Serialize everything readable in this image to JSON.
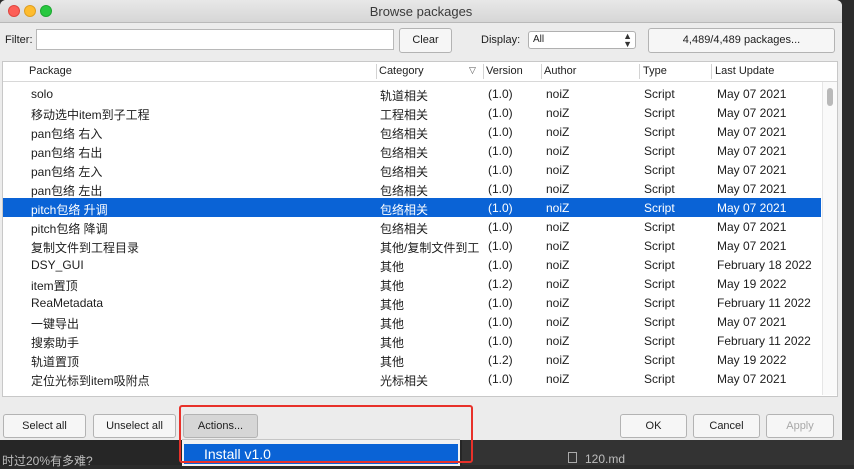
{
  "window": {
    "title": "Browse packages"
  },
  "filter": {
    "label": "Filter:",
    "value": "",
    "placeholder": ""
  },
  "toolbar": {
    "clear_label": "Clear",
    "display_label": "Display:",
    "display_value": "All",
    "packages_count": "4,489/4,489 packages..."
  },
  "columns": [
    "Package",
    "Category",
    "Version",
    "Author",
    "Type",
    "Last Update"
  ],
  "rows": [
    {
      "package": "solo",
      "category": "轨道相关",
      "version": "(1.0)",
      "author": "noiZ",
      "type": "Script",
      "updated": "May 07 2021"
    },
    {
      "package": "移动选中item到子工程",
      "category": "工程相关",
      "version": "(1.0)",
      "author": "noiZ",
      "type": "Script",
      "updated": "May 07 2021"
    },
    {
      "package": "pan包络 右入",
      "category": "包络相关",
      "version": "(1.0)",
      "author": "noiZ",
      "type": "Script",
      "updated": "May 07 2021"
    },
    {
      "package": "pan包络 右出",
      "category": "包络相关",
      "version": "(1.0)",
      "author": "noiZ",
      "type": "Script",
      "updated": "May 07 2021"
    },
    {
      "package": "pan包络 左入",
      "category": "包络相关",
      "version": "(1.0)",
      "author": "noiZ",
      "type": "Script",
      "updated": "May 07 2021"
    },
    {
      "package": "pan包络 左出",
      "category": "包络相关",
      "version": "(1.0)",
      "author": "noiZ",
      "type": "Script",
      "updated": "May 07 2021"
    },
    {
      "package": "pitch包络 升调",
      "category": "包络相关",
      "version": "(1.0)",
      "author": "noiZ",
      "type": "Script",
      "updated": "May 07 2021"
    },
    {
      "package": "pitch包络 降调",
      "category": "包络相关",
      "version": "(1.0)",
      "author": "noiZ",
      "type": "Script",
      "updated": "May 07 2021"
    },
    {
      "package": "复制文件到工程目录",
      "category": "其他/复制文件到工",
      "version": "(1.0)",
      "author": "noiZ",
      "type": "Script",
      "updated": "May 07 2021"
    },
    {
      "package": "DSY_GUI",
      "category": "其他",
      "version": "(1.0)",
      "author": "noiZ",
      "type": "Script",
      "updated": "February 18 2022"
    },
    {
      "package": "item置顶",
      "category": "其他",
      "version": "(1.2)",
      "author": "noiZ",
      "type": "Script",
      "updated": "May 19 2022"
    },
    {
      "package": "ReaMetadata",
      "category": "其他",
      "version": "(1.0)",
      "author": "noiZ",
      "type": "Script",
      "updated": "February 11 2022"
    },
    {
      "package": "一键导出",
      "category": "其他",
      "version": "(1.0)",
      "author": "noiZ",
      "type": "Script",
      "updated": "May 07 2021"
    },
    {
      "package": "搜索助手",
      "category": "其他",
      "version": "(1.0)",
      "author": "noiZ",
      "type": "Script",
      "updated": "February 11 2022"
    },
    {
      "package": "轨道置顶",
      "category": "其他",
      "version": "(1.2)",
      "author": "noiZ",
      "type": "Script",
      "updated": "May 19 2022"
    },
    {
      "package": "定位光标到item吸附点",
      "category": "光标相关",
      "version": "(1.0)",
      "author": "noiZ",
      "type": "Script",
      "updated": "May 07 2021"
    }
  ],
  "selected_row": 6,
  "footer": {
    "select_all": "Select all",
    "unselect_all": "Unselect all",
    "actions": "Actions...",
    "ok": "OK",
    "cancel": "Cancel",
    "apply": "Apply"
  },
  "dropdown": {
    "item": "Install v1.0"
  },
  "background": {
    "left_text": "时过20%有多难?",
    "right_text": "120.md"
  },
  "colors": {
    "selection": "#0a63d6",
    "highlight_box": "#e8312a"
  }
}
